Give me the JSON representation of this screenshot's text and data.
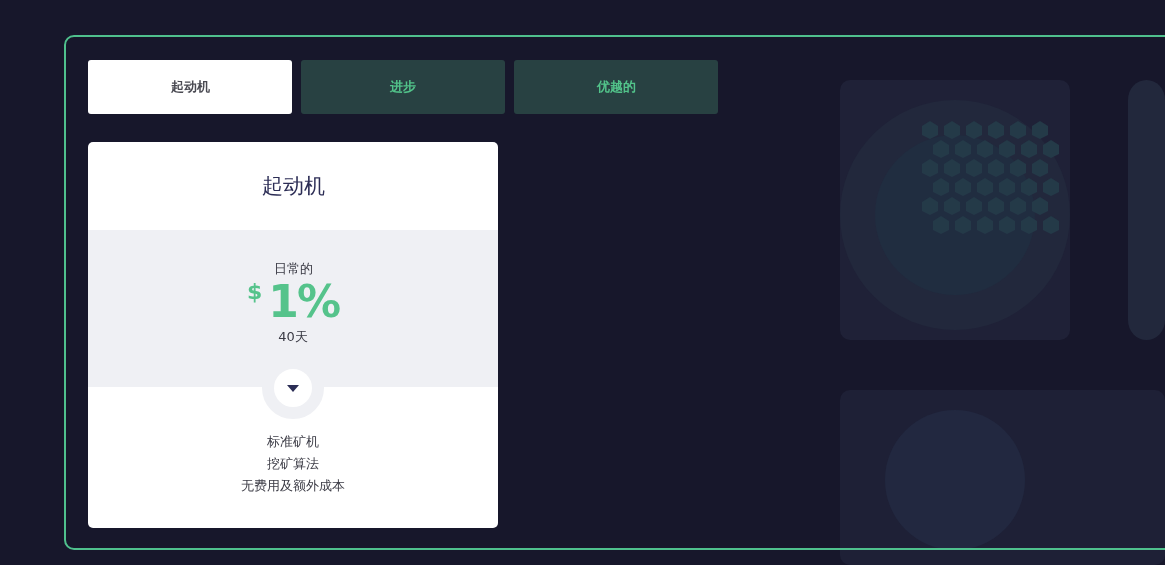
{
  "tabs": [
    {
      "label": "起动机",
      "selected": true
    },
    {
      "label": "进步",
      "selected": false
    },
    {
      "label": "优越的",
      "selected": false
    }
  ],
  "plan": {
    "title": "起动机",
    "period": "日常的",
    "currency": "$",
    "rate": "1%",
    "duration": "40天",
    "features": [
      "标准矿机",
      "挖矿算法",
      "无费用及额外成本"
    ]
  }
}
